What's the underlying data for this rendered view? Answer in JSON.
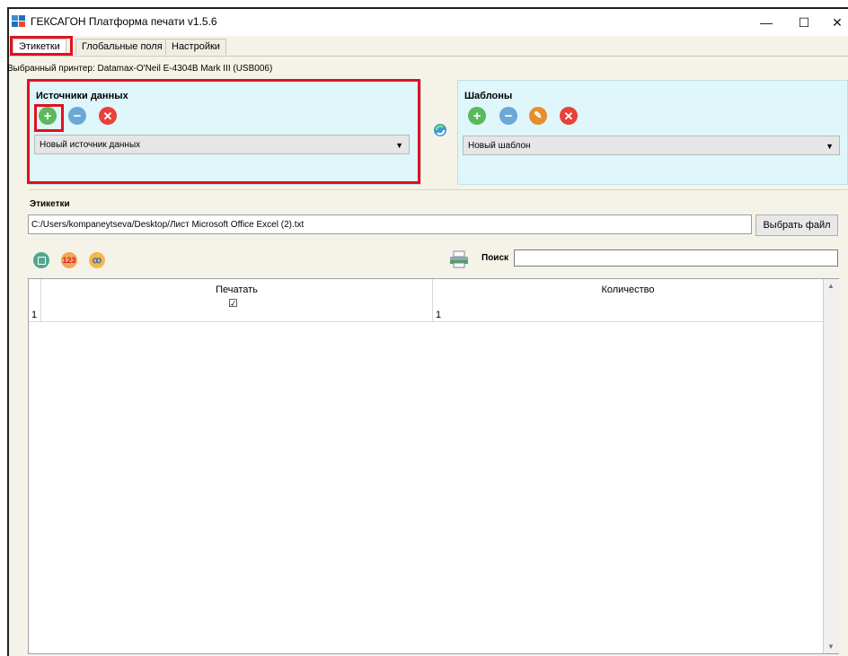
{
  "window": {
    "title": "ГЕКСАГОН Платформа печати  v1.5.6",
    "minimize": "—",
    "maximize": "☐",
    "close": "✕"
  },
  "tabs": [
    "Этикетки",
    "Глобальные поля",
    "Настройки"
  ],
  "printer": {
    "text": "Выбранный принтер: Datamax-O'Neil E-4304B Mark III (USB006)"
  },
  "sources": {
    "title": "Источники данных",
    "selected": "Новый источник данных",
    "buttons": [
      "plus-icon",
      "minus-icon",
      "close-icon"
    ]
  },
  "templates": {
    "title": "Шаблоны",
    "selected": "Новый шаблон",
    "buttons": [
      "plus-icon",
      "minus-icon",
      "edit-icon",
      "close-icon"
    ]
  },
  "labels": {
    "title": "Этикетки",
    "file_path": "C:/Users/kompaneytseva/Desktop/Лист Microsoft Office Excel (2).txt",
    "browse_label": "Выбрать файл",
    "toolbar": {
      "counter_icon_text": "123"
    },
    "search_label": "Поиск",
    "search_value": ""
  },
  "grid": {
    "columns": [
      "Печатать",
      "Количество"
    ],
    "rows": [
      {
        "row_number": "1",
        "print": "☑",
        "quantity": "1"
      }
    ]
  },
  "colors": {
    "highlight": "#e3101f",
    "panel_bg": "#dff6fb",
    "window_bg": "#f5f3e8"
  }
}
